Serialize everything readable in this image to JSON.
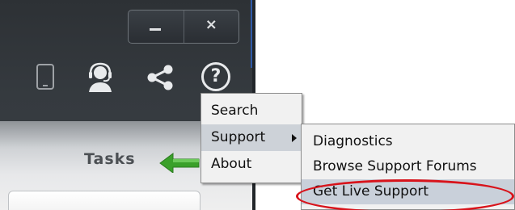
{
  "window_controls": {
    "minimize_icon": "minimize-icon",
    "close_symbol": "×"
  },
  "toolbar": {
    "icons": [
      "tablet-icon",
      "support-agent-icon",
      "share-icon",
      "help-icon"
    ],
    "help_symbol": "?"
  },
  "tasks": {
    "label": "Tasks"
  },
  "help_menu": {
    "items": [
      {
        "label": "Search"
      },
      {
        "label": "Support",
        "has_submenu": true
      },
      {
        "label": "About"
      }
    ]
  },
  "support_submenu": {
    "items": [
      {
        "label": "Diagnostics"
      },
      {
        "label": "Browse Support Forums"
      },
      {
        "label": "Get Live Support"
      }
    ]
  },
  "colors": {
    "annotation": "#d8131b",
    "arrow_green": "#3aa02a",
    "app_background": "#2d3135"
  }
}
